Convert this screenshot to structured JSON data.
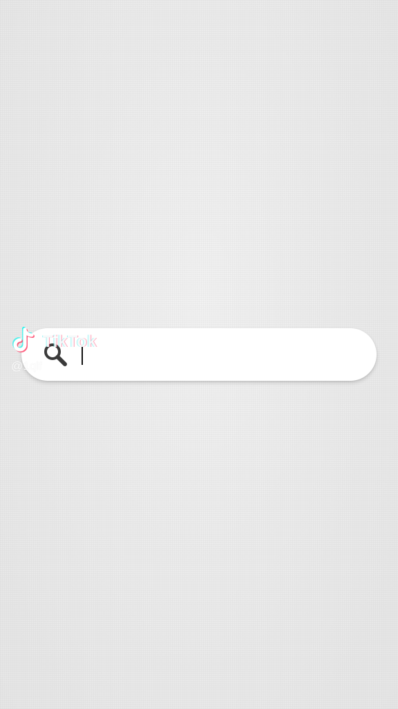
{
  "search": {
    "value": "",
    "icon": "search-icon"
  },
  "watermark": {
    "logo_icon": "tiktok-logo-icon",
    "brand": "TikTok",
    "handle": "@1qlf"
  },
  "colors": {
    "background": "#ebebeb",
    "search_bar": "#ffffff",
    "icon": "#3a3a3a",
    "tiktok_cyan": "#25f4ee",
    "tiktok_red": "#fe2c55"
  }
}
